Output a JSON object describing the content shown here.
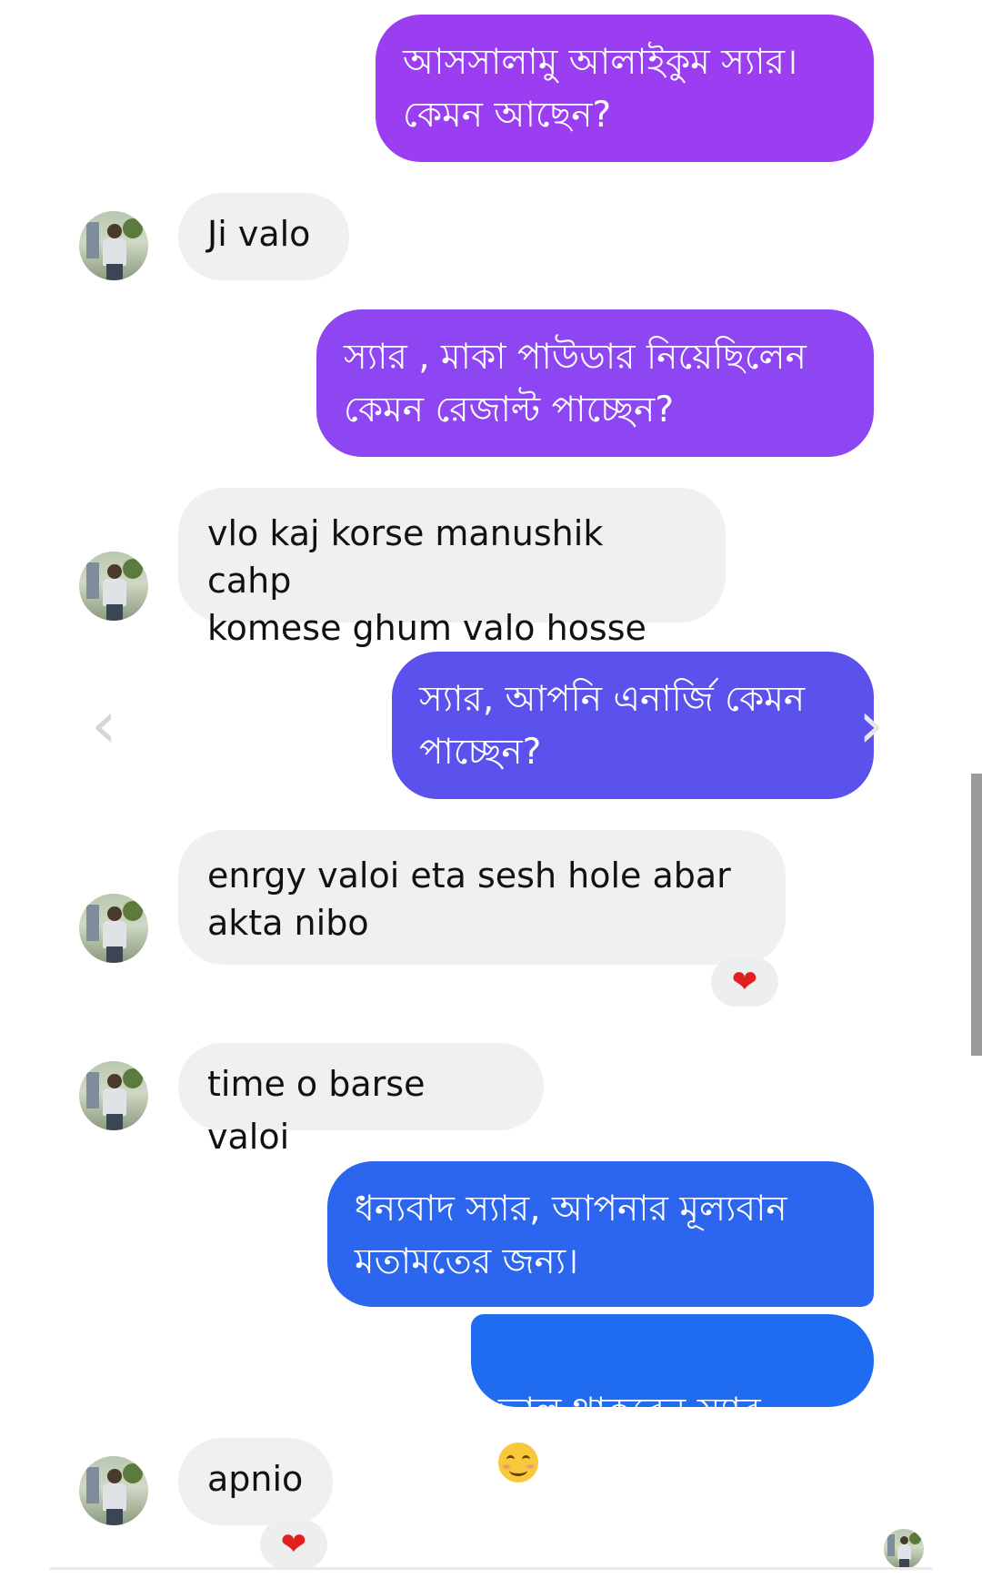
{
  "conversation": {
    "messages": [
      {
        "from": "me",
        "text": "আসসালামু আলাইকুম স্যার।\nকেমন আছেন?",
        "color": "#9b3df0"
      },
      {
        "from": "them",
        "text": "Ji valo"
      },
      {
        "from": "me",
        "text": "স্যার , মাকা পাউডার নিয়েছিলেন\nকেমন রেজাল্ট পাচ্ছেন?",
        "color": "#8e45f2"
      },
      {
        "from": "them",
        "text": "vlo kaj korse manushik cahp\nkomese ghum valo hosse"
      },
      {
        "from": "me",
        "text": "স্যার, আপনি এনার্জি কেমন\nপাচ্ছেন?",
        "color": "#5b52ee"
      },
      {
        "from": "them",
        "text": "enrgy valoi eta sesh hole abar\nakta nibo",
        "reaction": "❤"
      },
      {
        "from": "them",
        "text": "time o barse valoi"
      },
      {
        "from": "me",
        "text": "ধন্যবাদ স্যার,  আপনার মূল্যবান\nমতামতের জন্য।",
        "color": "#2c66ee"
      },
      {
        "from": "me",
        "text": "ভাল থাকবেন স্যার",
        "emoji": "smiling-face",
        "color": "#1f6cf0"
      },
      {
        "from": "them",
        "text": "apnio",
        "reaction": "❤"
      }
    ],
    "nav_prev_icon": "chevron-left-icon",
    "nav_next_icon": "chevron-right-icon",
    "prev_glyph": "‹",
    "next_glyph": "›"
  }
}
